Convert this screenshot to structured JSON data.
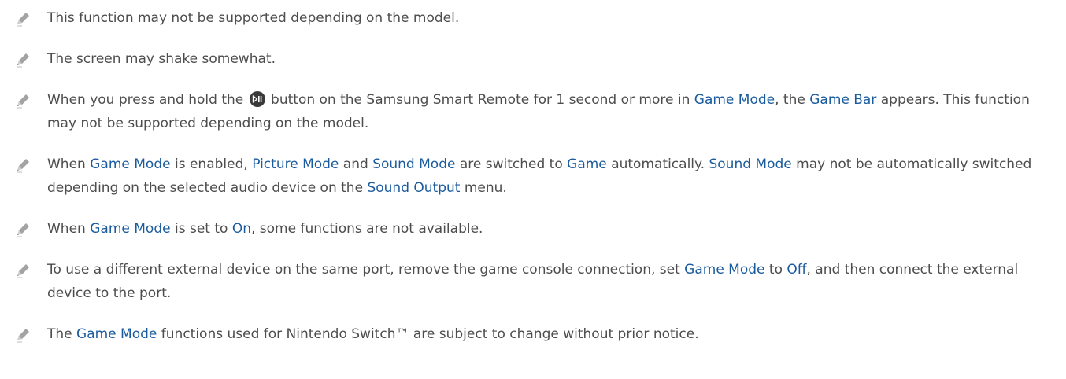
{
  "icons": {
    "note_icon": "pencil-icon",
    "remote_button_icon": "play-pause-icon"
  },
  "colors": {
    "text": "#4d4d4d",
    "highlight": "#1a5b9e",
    "icon": "#9a9a9a"
  },
  "notes": [
    {
      "text": "This function may not be supported depending on the model."
    },
    {
      "text": "The screen may shake somewhat."
    },
    {
      "parts": [
        "When you press and hold the",
        "button on the Samsung Smart Remote for 1 second or more in",
        "Game Mode",
        ", the",
        "Game Bar",
        "appears. This function may not be supported depending on the model."
      ]
    },
    {
      "parts": [
        "When",
        "Game Mode",
        "is enabled,",
        "Picture Mode",
        "and",
        "Sound Mode",
        "are switched to",
        "Game",
        "automatically.",
        "Sound Mode",
        "may not be automatically switched depending on the selected audio device on the",
        "Sound Output",
        "menu."
      ]
    },
    {
      "parts": [
        "When",
        "Game Mode",
        "is set to",
        "On",
        ", some functions are not available."
      ]
    },
    {
      "parts": [
        "To use a different external device on the same port, remove the game console connection, set",
        "Game Mode",
        "to",
        "Off",
        ", and then connect the external device to the port."
      ]
    },
    {
      "parts": [
        "The",
        "Game Mode",
        "functions used for Nintendo Switch™ are subject to change without prior notice."
      ]
    }
  ]
}
